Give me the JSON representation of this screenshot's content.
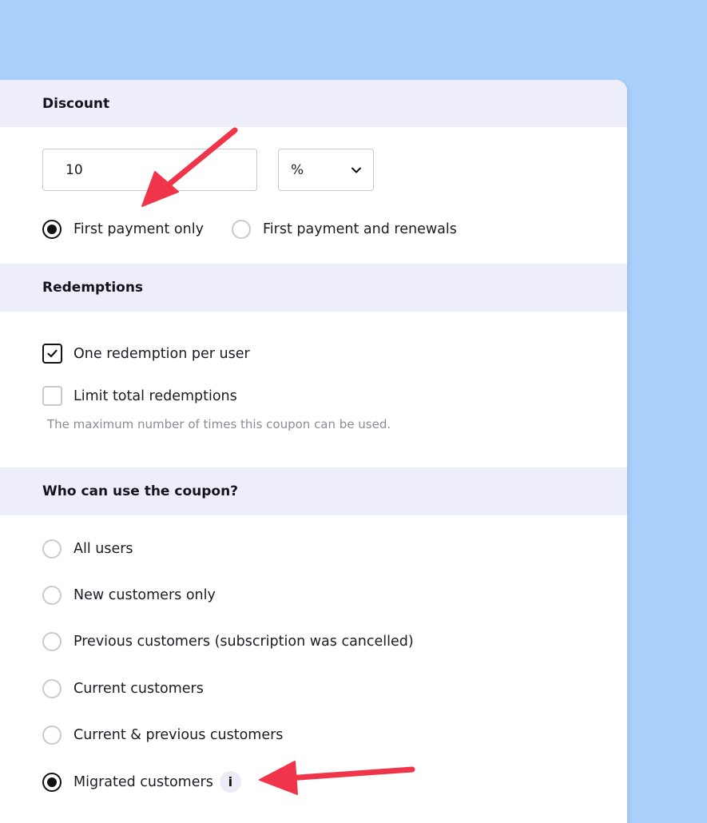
{
  "discount": {
    "heading": "Discount",
    "amount_value": "10",
    "unit_value": "%",
    "options": [
      {
        "label": "First payment only",
        "selected": true
      },
      {
        "label": "First payment and renewals",
        "selected": false
      }
    ]
  },
  "redemptions": {
    "heading": "Redemptions",
    "options": [
      {
        "label": "One redemption per user",
        "checked": true
      },
      {
        "label": "Limit total redemptions",
        "checked": false
      }
    ],
    "help_text": "The maximum number of times this coupon can be used."
  },
  "eligibility": {
    "heading": "Who can use the coupon?",
    "options": [
      {
        "label": "All users",
        "selected": false
      },
      {
        "label": "New customers only",
        "selected": false
      },
      {
        "label": "Previous customers (subscription was cancelled)",
        "selected": false
      },
      {
        "label": "Current customers",
        "selected": false
      },
      {
        "label": "Current & previous customers",
        "selected": false
      },
      {
        "label": "Migrated customers",
        "selected": true
      }
    ],
    "info_glyph": "i"
  },
  "colors": {
    "background": "#abd0fc",
    "section_header": "#eeeefa",
    "annotation_arrow": "#f0344a"
  },
  "icons": {
    "select_chevron": "chevron-down-icon",
    "info": "info-icon",
    "check": "checkmark-icon"
  }
}
